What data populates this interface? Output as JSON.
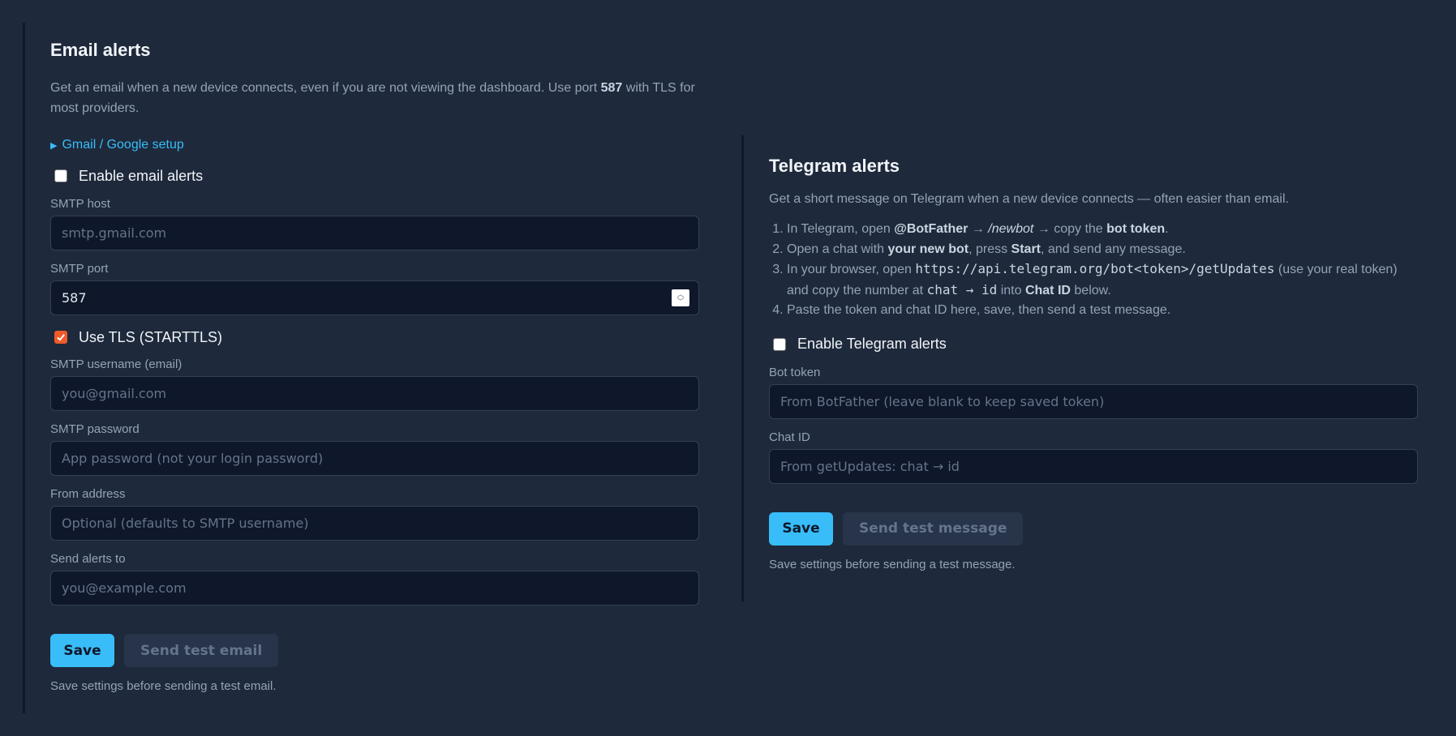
{
  "email": {
    "title": "Email alerts",
    "desc_1": "Get an email when a new device connects, even if you are not viewing the dashboard. Use port ",
    "desc_port": "587",
    "desc_2": " with TLS for most providers.",
    "setup_link": "Gmail / Google setup",
    "enable_label": "Enable email alerts",
    "enable_checked": false,
    "smtp_host_label": "SMTP host",
    "smtp_host_placeholder": "smtp.gmail.com",
    "smtp_port_label": "SMTP port",
    "smtp_port_value": "587",
    "tls_label": "Use TLS (STARTTLS)",
    "tls_checked": true,
    "username_label": "SMTP username (email)",
    "username_placeholder": "you@gmail.com",
    "password_label": "SMTP password",
    "password_placeholder": "App password (not your login password)",
    "from_label": "From address",
    "from_placeholder": "Optional (defaults to SMTP username)",
    "to_label": "Send alerts to",
    "to_placeholder": "you@example.com",
    "save_label": "Save",
    "test_label": "Send test email",
    "hint": "Save settings before sending a test email."
  },
  "telegram": {
    "title": "Telegram alerts",
    "desc": "Get a short message on Telegram when a new device connects — often easier than email.",
    "steps": {
      "s1_a": "In Telegram, open ",
      "s1_botfather": "@BotFather",
      "s1_b": " → ",
      "s1_newbot": "/newbot",
      "s1_c": " → copy the ",
      "s1_token": "bot token",
      "s1_d": ".",
      "s2_a": "Open a chat with ",
      "s2_bot": "your new bot",
      "s2_b": ", press ",
      "s2_start": "Start",
      "s2_c": ", and send any message.",
      "s3_a": "In your browser, open ",
      "s3_url": "https://api.telegram.org/bot<token>/getUpdates",
      "s3_b": " (use your real token) and copy the number at ",
      "s3_path": "chat → id",
      "s3_c": " into ",
      "s3_chatid": "Chat ID",
      "s3_d": " below.",
      "s4": "Paste the token and chat ID here, save, then send a test message."
    },
    "enable_label": "Enable Telegram alerts",
    "enable_checked": false,
    "token_label": "Bot token",
    "token_placeholder": "From BotFather (leave blank to keep saved token)",
    "chat_label": "Chat ID",
    "chat_placeholder": "From getUpdates: chat → id",
    "save_label": "Save",
    "test_label": "Send test message",
    "hint": "Save settings before sending a test message."
  },
  "colors": {
    "background": "#1e293b",
    "input_bg": "#0f172a",
    "accent": "#38bdf8",
    "checkbox_checked": "#ef5b2a"
  }
}
